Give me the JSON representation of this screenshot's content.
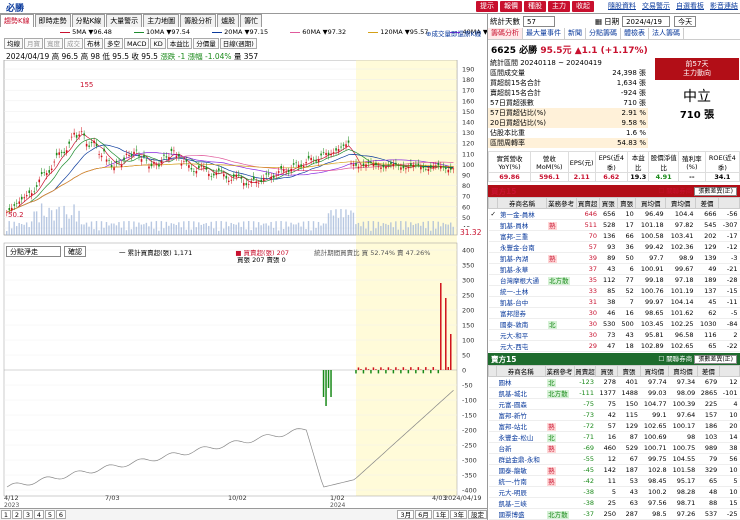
{
  "window": {
    "title": "必勝"
  },
  "top_buttons": [
    "提示",
    "報價",
    "種股",
    "主力",
    "收起"
  ],
  "top_links": [
    "隨股資料",
    "交易警示",
    "自選看板",
    "影音連結"
  ],
  "tabs": [
    "趨勢K線",
    "即時走勢",
    "分點K線",
    "大量警示",
    "主力地圖",
    "籌股分析",
    "爐股",
    "籌忙"
  ],
  "chart_toolbar": {
    "buttons": [
      "均線",
      "月寶",
      "寬度",
      "成交",
      "布林",
      "多空",
      "MACD",
      "KD",
      "本益比",
      "分價量",
      "日線(週期)"
    ],
    "dim": [
      false,
      true,
      true,
      true,
      false,
      false,
      false,
      false,
      false,
      false,
      false
    ]
  },
  "ma_legend": [
    {
      "label": "5MA ▼96.48",
      "color": "#c8102e"
    },
    {
      "label": "10MA ▼97.54",
      "color": "#1d8c2e"
    },
    {
      "label": "20MA ▼97.15",
      "color": "#0a3a9c"
    },
    {
      "label": "60MA ▼97.32",
      "color": "#e05a9c"
    },
    {
      "label": "120MA ▼95.57",
      "color": "#d4a017"
    },
    {
      "label": "40MA ▼97.19",
      "color": "#8a2be2"
    }
  ],
  "note_tag": "⊕成交量即還原K線",
  "quote_line": {
    "date": "2024/04/19",
    "text": "高 96.5  高 98  低 95.5  收 95.5",
    "change": "漲跌 -1  漲幅 -1.04%",
    "volume": "量 357"
  },
  "price_axis": [
    "190",
    "180",
    "170",
    "160",
    "150",
    "140",
    "130",
    "120",
    "110",
    "100",
    "90",
    "80",
    "70",
    "60",
    "50",
    "40"
  ],
  "price_marker": "31.32",
  "peak_label": "155",
  "low_label": "50.2",
  "lower_panel": {
    "select": "分點淨走",
    "button": "確認",
    "legend1": "一 累計買賣超(張) 1,171",
    "legend2": "■ 買賣超(張) 207",
    "legend2b": "買張 207 賣張 0",
    "legend3": "統計期間買賣比 買 52.74%  賣 47.26%",
    "axis": [
      "400",
      "350",
      "300",
      "250",
      "200",
      "150",
      "100",
      "50",
      "0",
      "-50",
      "-100",
      "-150",
      "-200",
      "-250",
      "-300",
      "-350",
      "-400"
    ]
  },
  "x_axis": [
    "4/12",
    "7/03",
    "10/02",
    "1/02",
    "4/03",
    "2024/04/19"
  ],
  "x_axis_sub": [
    "2023",
    "2024"
  ],
  "bottom_bar": {
    "pages": [
      "1",
      "2",
      "3",
      "4",
      "5",
      "6"
    ],
    "periods": [
      "3月",
      "6月",
      "1年",
      "3年",
      "設定"
    ]
  },
  "right": {
    "header": {
      "label": "統計天數",
      "days": "57",
      "date_label": "日期",
      "date": "2024/4/19",
      "today": "今天"
    },
    "tabs": [
      "籌碼分析",
      "最大量事件",
      "新聞",
      "分點籌碼",
      "體檢表",
      "法人籌碼"
    ],
    "stock": {
      "code": "6625 必勝",
      "price": "95.5元",
      "change": "▲1.1 (+1.17%)"
    },
    "period": "統計區間 20240118 ~ 20240419",
    "stats": [
      {
        "k": "區間成交量",
        "v": "24,398 張"
      },
      {
        "k": "買超前15名合計",
        "v": "1,634 張"
      },
      {
        "k": "賣超前15名合計",
        "v": "-924 張"
      },
      {
        "k": "57日買超張數",
        "v": "710 張"
      },
      {
        "k": "57日買超佔比(%)",
        "v": "2.91 %"
      },
      {
        "k": "20日買超佔比(%)",
        "v": "9.58 %"
      },
      {
        "k": "佔股本比重",
        "v": "1.6 %"
      },
      {
        "k": "區間周轉率",
        "v": "54.83 %"
      }
    ],
    "flow_box": {
      "title": "前57天",
      "subtitle": "主力動向",
      "state": "中立",
      "amount": "710 張"
    },
    "metrics_head": [
      "實質營收YoY(%)",
      "營收MoM(%)",
      "EPS(元)",
      "EPS(近4季)",
      "本益比",
      "股價淨值比",
      "殖利率(%)",
      "ROE(近4季)"
    ],
    "metrics_val": [
      "69.86",
      "596.1",
      "2.11",
      "6.62",
      "19.3",
      "4.91",
      "--",
      "34.1"
    ],
    "buy_title": "買方15",
    "sell_title": "賣方15",
    "link_label": "關聯券商",
    "sort_label": "張數差異(正)",
    "cols": [
      "",
      "券商名稱",
      "業務參考",
      "買賣超",
      "買張",
      "賣張",
      "買均價",
      "賣均價",
      "差價"
    ],
    "buy_rows": [
      [
        "✓",
        "第一金-員林",
        "",
        "646",
        "656",
        "10",
        "96.49",
        "104.4",
        "666",
        "-56"
      ],
      [
        "",
        "凱基-員林",
        "熟",
        "511",
        "528",
        "17",
        "101.18",
        "97.82",
        "545",
        "-307"
      ],
      [
        "",
        "富邦-三重",
        "",
        "70",
        "136",
        "66",
        "100.58",
        "103.41",
        "202",
        "-17"
      ],
      [
        "",
        "永豐金-台南",
        "",
        "57",
        "93",
        "36",
        "99.42",
        "102.36",
        "129",
        "-12"
      ],
      [
        "",
        "凱基-內湖",
        "熟",
        "39",
        "89",
        "50",
        "97.7",
        "98.9",
        "139",
        "-3"
      ],
      [
        "",
        "凱基-永華",
        "",
        "37",
        "43",
        "6",
        "100.91",
        "99.67",
        "49",
        "-21"
      ],
      [
        "",
        "台灣摩根大通",
        "北方散",
        "35",
        "112",
        "77",
        "99.18",
        "97.18",
        "189",
        "-28"
      ],
      [
        "",
        "統一-土林",
        "",
        "33",
        "85",
        "52",
        "100.76",
        "101.19",
        "137",
        "-15"
      ],
      [
        "",
        "凱基-台中",
        "",
        "31",
        "38",
        "7",
        "99.97",
        "104.14",
        "45",
        "-11"
      ],
      [
        "",
        "富邦證券",
        "",
        "30",
        "46",
        "16",
        "98.65",
        "101.62",
        "62",
        "-5"
      ],
      [
        "",
        "國泰-敦南",
        "北",
        "30",
        "530",
        "500",
        "103.45",
        "102.25",
        "1030",
        "-84"
      ],
      [
        "",
        "元大-和平",
        "",
        "30",
        "73",
        "43",
        "95.81",
        "96.58",
        "116",
        "2"
      ],
      [
        "",
        "元大-西屯",
        "",
        "29",
        "47",
        "18",
        "102.89",
        "102.65",
        "65",
        "-22"
      ]
    ],
    "sell_rows": [
      [
        "",
        "圓林",
        "北",
        "-123",
        "278",
        "401",
        "97.74",
        "97.34",
        "679",
        "12"
      ],
      [
        "",
        "凱基-城北",
        "北方散",
        "-111",
        "1377",
        "1488",
        "99.03",
        "98.09",
        "2865",
        "-101"
      ],
      [
        "",
        "元富-圓森",
        "",
        "-75",
        "75",
        "150",
        "104.77",
        "100.39",
        "225",
        "4"
      ],
      [
        "",
        "富邦-新竹",
        "",
        "-73",
        "42",
        "115",
        "99.1",
        "97.64",
        "157",
        "10"
      ],
      [
        "",
        "富邦-站北",
        "熟",
        "-72",
        "57",
        "129",
        "102.65",
        "100.17",
        "186",
        "20"
      ],
      [
        "",
        "永豐金-松山",
        "北",
        "-71",
        "16",
        "87",
        "100.69",
        "98",
        "103",
        "14"
      ],
      [
        "",
        "台新",
        "熟",
        "-69",
        "460",
        "529",
        "100.71",
        "100.75",
        "989",
        "38"
      ],
      [
        "",
        "群益金鼎-永和",
        "",
        "-55",
        "12",
        "67",
        "99.75",
        "104.55",
        "79",
        "56"
      ],
      [
        "",
        "國泰-龍敏",
        "熟",
        "-45",
        "142",
        "187",
        "102.8",
        "101.58",
        "329",
        "10"
      ],
      [
        "",
        "統一-竹南",
        "熟",
        "-42",
        "11",
        "53",
        "98.45",
        "95.17",
        "65",
        "5"
      ],
      [
        "",
        "元大-明辰",
        "",
        "-38",
        "5",
        "43",
        "100.2",
        "98.28",
        "48",
        "10"
      ],
      [
        "",
        "凱基-三峽",
        "",
        "-38",
        "25",
        "63",
        "97.56",
        "98.71",
        "88",
        "15"
      ],
      [
        "",
        "國票博盛",
        "北方散",
        "-37",
        "250",
        "287",
        "98.5",
        "97.26",
        "537",
        "-25"
      ]
    ]
  }
}
